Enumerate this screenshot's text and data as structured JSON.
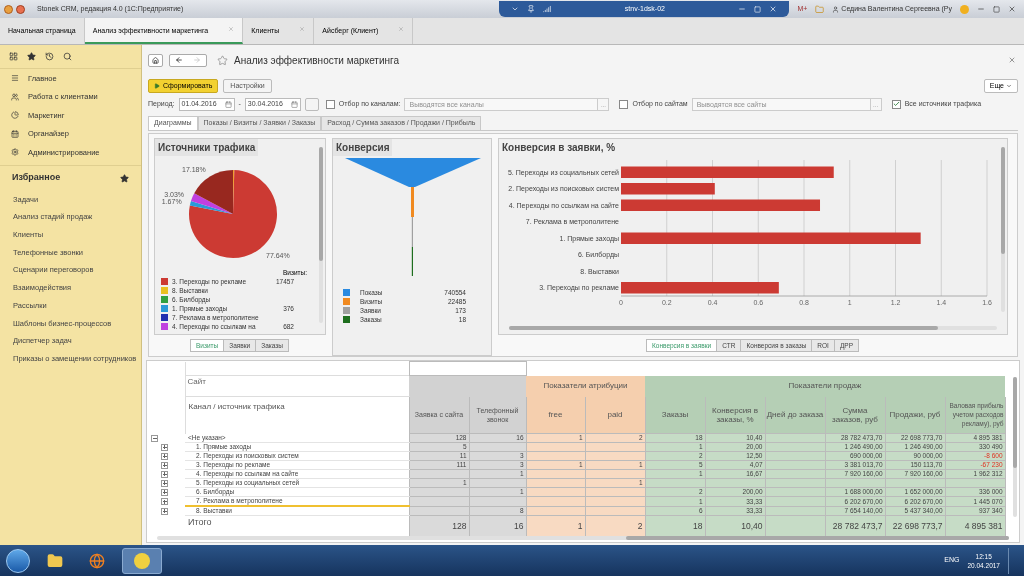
{
  "app_title": "Stonek CRM, редакция 4.0 (1С:Предприятие)",
  "remote_bar": {
    "host": "stnv-1dsk-02"
  },
  "system_bar": {
    "m_label": "M+",
    "user": "Седина Валентина Сергеевна (Ру"
  },
  "open_tabs": [
    {
      "label": "Начальная страница",
      "selected": false,
      "closable": false
    },
    {
      "label": "Анализ эффективности маркетинга",
      "selected": true,
      "closable": true
    },
    {
      "label": "Клиенты",
      "selected": false,
      "closable": true
    },
    {
      "label": "Айсберг (Клиент)",
      "selected": false,
      "closable": true
    }
  ],
  "sidebar": {
    "sections": [
      "Главное",
      "Работа с клиентами",
      "Маркетинг",
      "Органайзер",
      "Администрирование"
    ],
    "favorites_title": "Избранное",
    "favorites": [
      "Задачи",
      "Анализ стадий продаж",
      "Клиенты",
      "Телефонные звонки",
      "Сценарии переговоров",
      "Взаимодействия",
      "Рассылки",
      "Шаблоны бизнес-процессов",
      "Диспетчер задач",
      "Приказы о замещении сотрудников"
    ]
  },
  "form": {
    "title": "Анализ эффективности маркетинга",
    "run_button": "Сформировать",
    "settings_button": "Настройки",
    "more_button": "Еще",
    "period_label": "Период:",
    "date_from": "01.04.2016",
    "dash": "-",
    "date_to": "30.04.2016",
    "channel_filter": {
      "label": "Отбор по каналам:",
      "checked": false,
      "placeholder": "Выводятся все каналы",
      "select_button": "..."
    },
    "site_filter": {
      "label": "Отбор по сайтам",
      "checked": false,
      "placeholder": "Выводятся все сайты",
      "select_button": "..."
    },
    "all_sources": {
      "label": "Все источники трафика",
      "checked": true
    }
  },
  "tabs": [
    {
      "label": "Диаграммы",
      "selected": true
    },
    {
      "label": "Показы / Визиты / Заявки / Заказы",
      "selected": false
    },
    {
      "label": "Расход / Сумма заказов / Продажи / Прибыль",
      "selected": false
    }
  ],
  "traffic_panel": {
    "title": "Источники трафика",
    "chart_data": {
      "type": "pie",
      "series": [
        {
          "values": [
            0.48,
            77.64,
            1.67,
            3.03,
            17.18
          ]
        }
      ],
      "value_labels": [
        null,
        "77.64%",
        "1.67%",
        "3.03%",
        "17.18%"
      ]
    },
    "legend_header": "Визиты:",
    "legend": [
      {
        "label": "3. Переходы по рекламе",
        "color": "#cc3a33",
        "value": "17457"
      },
      {
        "label": "8. Выставки",
        "color": "#e8c020"
      },
      {
        "label": "6. Билборды",
        "color": "#30a040"
      },
      {
        "label": "1. Прямые заходы",
        "color": "#2a9ad8",
        "value": "376"
      },
      {
        "label": "7. Реклама в метрополитене",
        "color": "#2030b0"
      },
      {
        "label": "4. Переходы по ссылкам на",
        "color": "#c040e0",
        "value": "682"
      }
    ],
    "buttons": [
      {
        "label": "Визиты",
        "selected": true
      },
      {
        "label": "Заявки",
        "selected": false
      },
      {
        "label": "Заказы",
        "selected": false
      }
    ]
  },
  "conversion_panel": {
    "title": "Конверсия",
    "legend": [
      {
        "label": "Показы",
        "color": "#2a8ae0",
        "value": "740554"
      },
      {
        "label": "Визиты",
        "color": "#f08a20",
        "value": "22485"
      },
      {
        "label": "Заявки",
        "color": "#a0a0a0",
        "value": "173"
      },
      {
        "label": "Заказы",
        "color": "#1e6e1e",
        "value": "18"
      }
    ]
  },
  "bar_panel": {
    "title": "Конверсия в заявки, %",
    "chart_data": {
      "type": "bar",
      "orientation": "horizontal",
      "categories": [
        "5. Переходы из социальных сетей",
        "2. Переходы из поисковых систем",
        "4. Переходы по ссылкам на сайте",
        "7. Реклама в метрополитене",
        "1. Прямые заходы",
        "6. Билборды",
        "8. Выставки",
        "3. Переходы по рекламе"
      ],
      "series": [
        {
          "color": "#cc3a33",
          "values": [
            0.93,
            0.41,
            0.87,
            0,
            1.31,
            0,
            0,
            0.69
          ]
        }
      ],
      "xlim": [
        0,
        1.6
      ],
      "grid": true,
      "xticks": [
        0,
        0.2,
        0.4,
        0.6,
        0.8,
        1,
        1.2,
        1.4,
        1.6
      ]
    },
    "buttons": [
      {
        "label": "Конверсия в заявки",
        "selected": true
      },
      {
        "label": "CTR",
        "selected": false
      },
      {
        "label": "Конверсия в заказы",
        "selected": false
      },
      {
        "label": "ROI",
        "selected": false
      },
      {
        "label": "ДРР",
        "selected": false
      }
    ]
  },
  "table": {
    "site_header": "Сайт",
    "channel_header": "Канал / источник трафика",
    "group_titles": {
      "attribution": "Показатели атрибуции",
      "sales": "Показатели продаж"
    },
    "columns": [
      {
        "label": "Заявка с сайта",
        "kind": "requests"
      },
      {
        "label": "Телефонный звонок",
        "kind": "requests"
      },
      {
        "label": "free",
        "kind": "attribution"
      },
      {
        "label": "paid",
        "kind": "attribution"
      },
      {
        "label": "Заказы",
        "kind": "sales"
      },
      {
        "label": "Конверсия в заказы, %",
        "kind": "sales"
      },
      {
        "label": "Дней до заказа",
        "kind": "sales"
      },
      {
        "label": "Сумма заказов, руб",
        "kind": "sales"
      },
      {
        "label": "Продажи, руб",
        "kind": "sales"
      },
      {
        "label": "Валовая прибыль учетом расходов рекламу), руб",
        "kind": "sales"
      }
    ],
    "rows": [
      {
        "label": "<Не указан>",
        "expanded": true,
        "selected": false,
        "cells": [
          "128",
          "16",
          "1",
          "2",
          "18",
          "10,40",
          null,
          "28 782 473,70",
          "22 698 773,70",
          "4 895 381"
        ],
        "children": [
          {
            "label": "1. Прямые заходы",
            "expanded": false,
            "selected": false,
            "cells": [
              "5",
              null,
              null,
              null,
              "1",
              "20,00",
              null,
              "1 246 490,00",
              "1 246 490,00",
              "330 490"
            ]
          },
          {
            "label": "2. Переходы из поисковых систем",
            "expanded": false,
            "selected": false,
            "cells": [
              "11",
              "3",
              null,
              null,
              "2",
              "12,50",
              null,
              "690 000,00",
              "90 000,00",
              {
                "text": "-8 600",
                "negative": true
              }
            ]
          },
          {
            "label": "3. Переходы по рекламе",
            "expanded": false,
            "selected": false,
            "cells": [
              "111",
              "3",
              "1",
              "1",
              "5",
              "4,07",
              null,
              "3 381 013,70",
              "150 113,70",
              {
                "text": "-67 230",
                "negative": true
              }
            ]
          },
          {
            "label": "4. Переходы по ссылкам на сайте",
            "expanded": false,
            "selected": false,
            "cells": [
              null,
              "1",
              null,
              null,
              "1",
              "16,67",
              null,
              "7 920 160,00",
              "7 920 160,00",
              "1 962 312"
            ]
          },
          {
            "label": "5. Переходы из социальных сетей",
            "expanded": false,
            "selected": false,
            "cells": [
              "1",
              null,
              null,
              "1",
              null,
              null,
              null,
              null,
              null,
              null
            ]
          },
          {
            "label": "6. Билборды",
            "expanded": false,
            "selected": false,
            "cells": [
              null,
              "1",
              null,
              null,
              "2",
              "200,00",
              null,
              "1 688 000,00",
              "1 652 000,00",
              "336 000"
            ]
          },
          {
            "label": "7. Реклама в метрополитене",
            "expanded": false,
            "selected": true,
            "cells": [
              null,
              null,
              null,
              null,
              "1",
              "33,33",
              null,
              "6 202 670,00",
              "6 202 670,00",
              "1 445 070"
            ]
          },
          {
            "label": "8. Выставки",
            "expanded": false,
            "selected": false,
            "cells": [
              null,
              "8",
              null,
              null,
              "6",
              "33,33",
              null,
              "7 654 140,00",
              "5 437 340,00",
              "937 340"
            ]
          }
        ]
      }
    ],
    "total": {
      "label": "Итого",
      "cells": [
        "128",
        "16",
        "1",
        "2",
        "18",
        "10,40",
        null,
        "28 782 473,7",
        "22 698 773,7",
        "4 895 381"
      ]
    }
  },
  "taskbar": {
    "language": "ENG",
    "time": "12:15",
    "date": "20.04.2017"
  }
}
